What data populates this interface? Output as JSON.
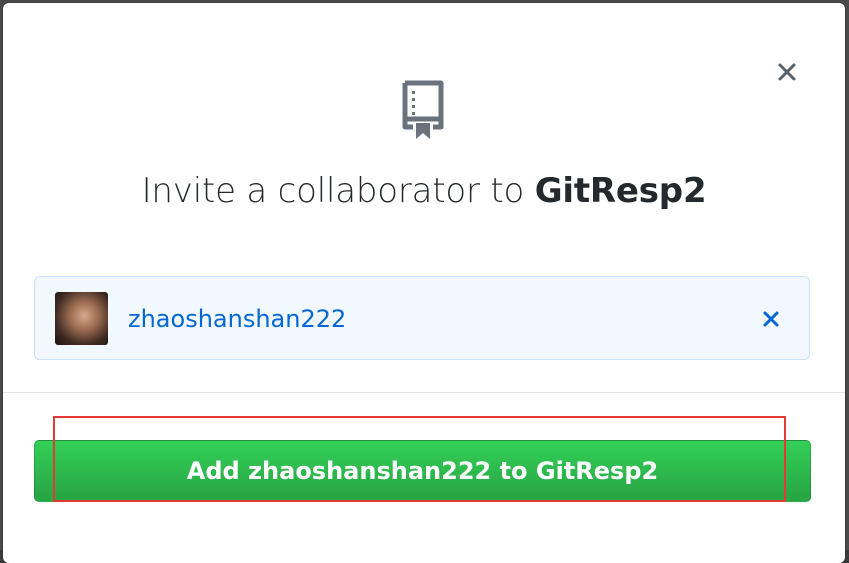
{
  "dialog": {
    "title_prefix": "Invite a collaborator to ",
    "repo_name": "GitResp2",
    "close_icon": "close-icon",
    "repo_icon": "repo-book-icon"
  },
  "selected_user": {
    "username": "zhaoshanshan222",
    "avatar": "user-avatar",
    "remove_icon": "close-icon"
  },
  "action": {
    "add_button_label": "Add zhaoshanshan222 to GitResp2"
  },
  "colors": {
    "link": "#0366d6",
    "primary_button": "#2ea44f",
    "highlight": "#e53935",
    "user_box_bg": "#f1f8ff"
  }
}
